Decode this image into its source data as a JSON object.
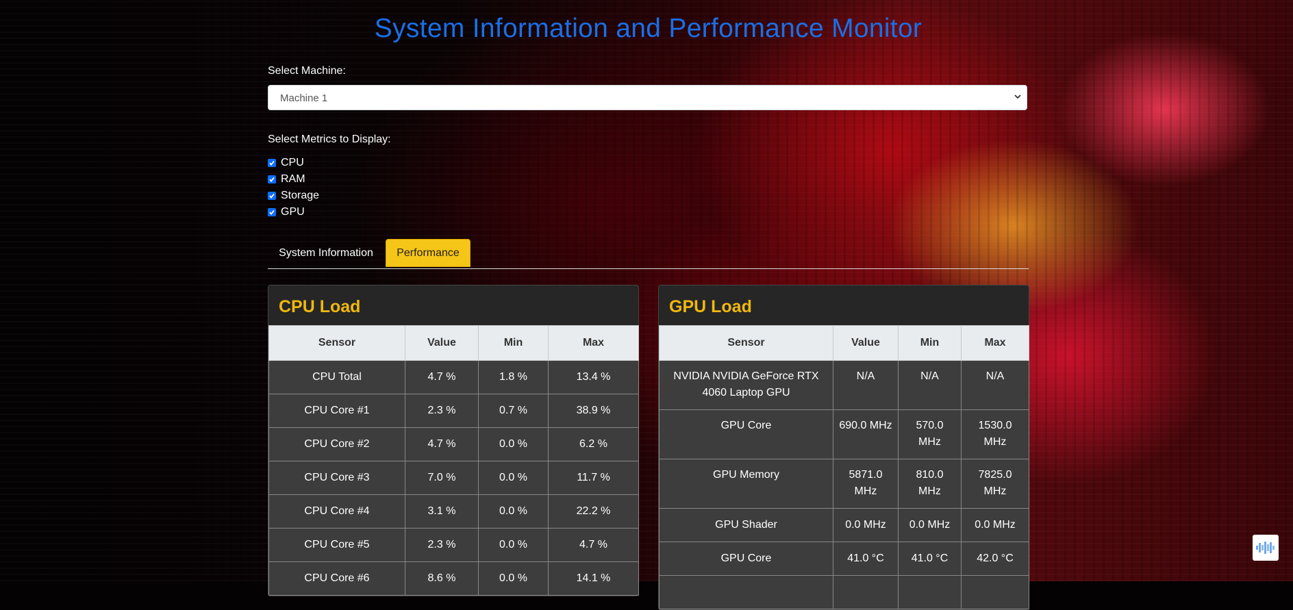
{
  "header": {
    "title": "System Information and Performance Monitor"
  },
  "machine_select": {
    "label": "Select Machine:",
    "value": "Machine 1"
  },
  "metrics": {
    "label": "Select Metrics to Display:",
    "items": [
      {
        "label": "CPU",
        "checked": true
      },
      {
        "label": "RAM",
        "checked": true
      },
      {
        "label": "Storage",
        "checked": true
      },
      {
        "label": "GPU",
        "checked": true
      }
    ]
  },
  "tabs": [
    {
      "label": "System Information",
      "active": false
    },
    {
      "label": "Performance",
      "active": true
    }
  ],
  "cpu_load": {
    "title": "CPU Load",
    "columns": [
      "Sensor",
      "Value",
      "Min",
      "Max"
    ],
    "rows": [
      [
        "CPU Total",
        "4.7 %",
        "1.8 %",
        "13.4 %"
      ],
      [
        "CPU Core #1",
        "2.3 %",
        "0.7 %",
        "38.9 %"
      ],
      [
        "CPU Core #2",
        "4.7 %",
        "0.0 %",
        "6.2 %"
      ],
      [
        "CPU Core #3",
        "7.0 %",
        "0.0 %",
        "11.7 %"
      ],
      [
        "CPU Core #4",
        "3.1 %",
        "0.0 %",
        "22.2 %"
      ],
      [
        "CPU Core #5",
        "2.3 %",
        "0.0 %",
        "4.7 %"
      ],
      [
        "CPU Core #6",
        "8.6 %",
        "0.0 %",
        "14.1 %"
      ]
    ]
  },
  "gpu_load": {
    "title": "GPU Load",
    "columns": [
      "Sensor",
      "Value",
      "Min",
      "Max"
    ],
    "rows": [
      [
        "NVIDIA NVIDIA GeForce RTX 4060 Laptop GPU",
        "N/A",
        "N/A",
        "N/A"
      ],
      [
        "GPU Core",
        "690.0 MHz",
        "570.0 MHz",
        "1530.0 MHz"
      ],
      [
        "GPU Memory",
        "5871.0 MHz",
        "810.0 MHz",
        "7825.0 MHz"
      ],
      [
        "GPU Shader",
        "0.0 MHz",
        "0.0 MHz",
        "0.0 MHz"
      ],
      [
        "GPU Core",
        "41.0 °C",
        "41.0 °C",
        "42.0 °C"
      ]
    ]
  },
  "colors": {
    "title": "#1a6fe8",
    "card_title": "#f0b80f",
    "active_tab": "#f5c518"
  }
}
